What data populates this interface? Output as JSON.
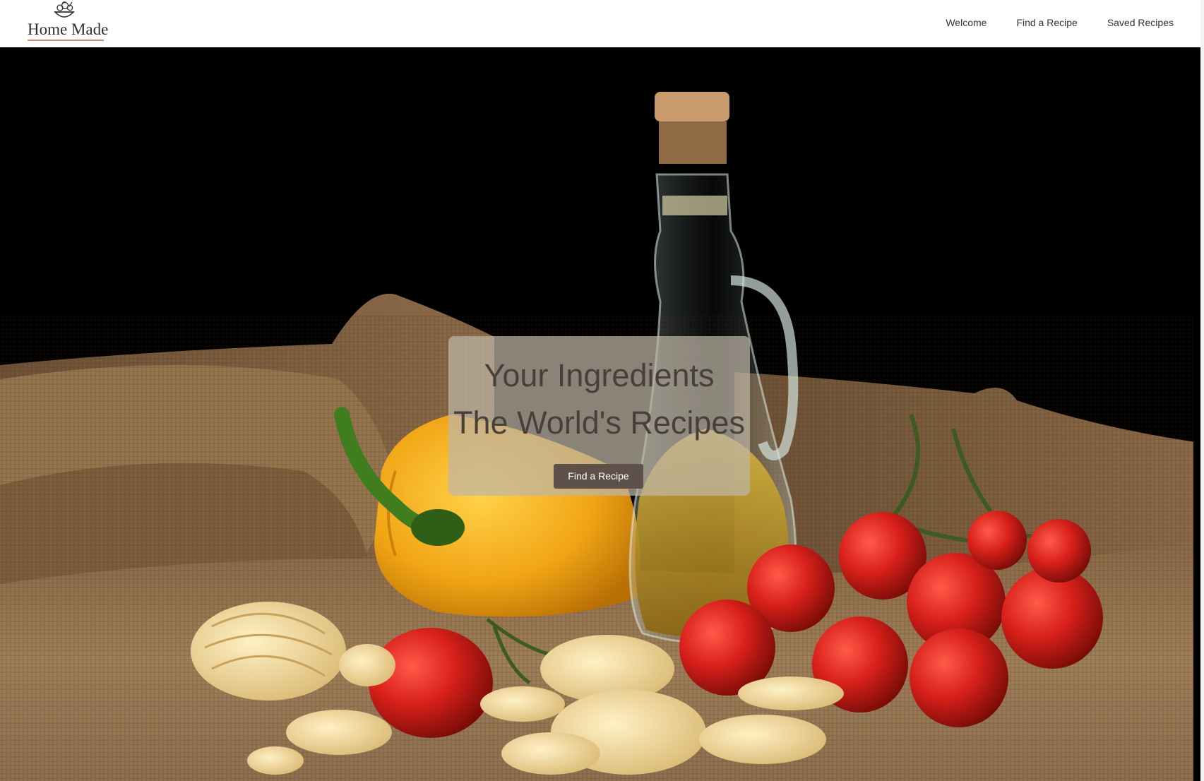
{
  "brand": {
    "name": "Home Made",
    "logo_icon": "salad-bowl-icon",
    "accent_color": "#c98d76"
  },
  "nav": {
    "items": [
      {
        "label": "Welcome"
      },
      {
        "label": "Find a Recipe"
      },
      {
        "label": "Saved Recipes"
      }
    ]
  },
  "hero": {
    "image": "still life of burlap, yellow bell pepper, olive oil bottle, cherry tomatoes and assorted dry pasta on black background",
    "headline_line1": "Your Ingredients",
    "headline_line2": "The World's Recipes",
    "cta_label": "Find a Recipe",
    "cta_color": "#5e514a"
  }
}
